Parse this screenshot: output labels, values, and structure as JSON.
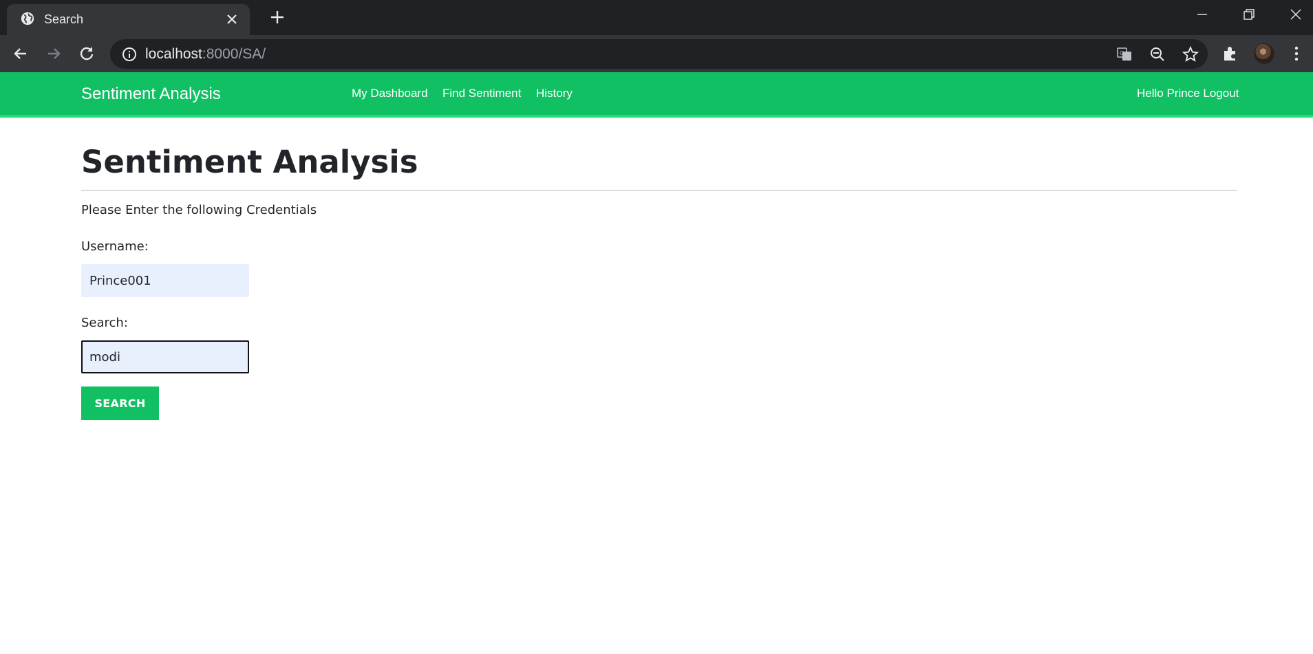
{
  "browser": {
    "tab_title": "Search",
    "url_host": "localhost",
    "url_rest": ":8000/SA/",
    "icons": {
      "favicon": "globe-icon",
      "close": "close-icon",
      "new_tab": "plus-icon",
      "back": "arrow-left-icon",
      "forward": "arrow-right-icon",
      "reload": "reload-icon",
      "site_info": "info-icon",
      "translate": "translate-icon",
      "zoom": "zoom-out-icon",
      "bookmark": "star-icon",
      "extensions": "puzzle-icon",
      "profile": "avatar",
      "menu": "kebab-menu-icon"
    }
  },
  "navbar": {
    "brand": "Sentiment Analysis",
    "links": [
      "My Dashboard",
      "Find Sentiment",
      "History"
    ],
    "user": "Hello Prince Logout",
    "color": "#12c064"
  },
  "main": {
    "title": "Sentiment Analysis",
    "intro": "Please Enter the following Credentials",
    "username_label": "Username:",
    "username_value": "Prince001",
    "search_label": "Search:",
    "search_value": "modi",
    "search_button": "SEARCH"
  }
}
